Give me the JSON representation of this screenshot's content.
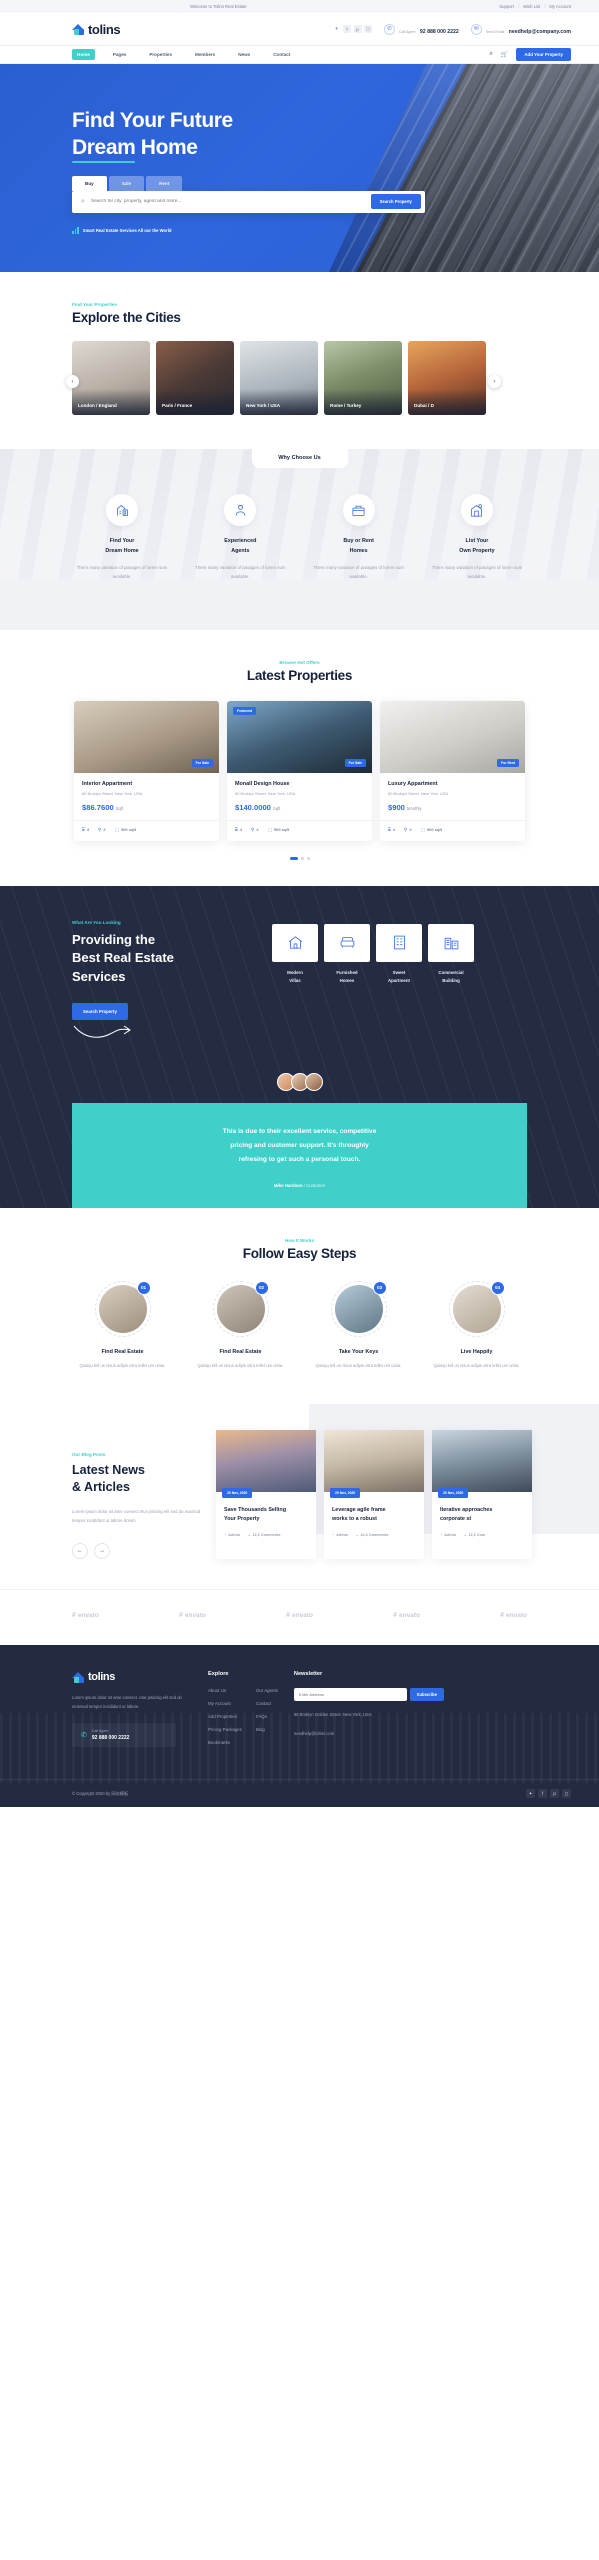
{
  "topbar": {
    "welcome": "Welcome to Tolins Real Estate",
    "links": [
      "Support",
      "Wish List",
      "My Account"
    ]
  },
  "brand": {
    "name": "tolins"
  },
  "header": {
    "social": [
      "twitter-icon",
      "facebook-icon",
      "pinterest-icon",
      "instagram-icon"
    ],
    "call": {
      "label": "Call Agent",
      "value": "92 888 000 2222"
    },
    "email": {
      "label": "Send Email",
      "value": "needhelp@company.com"
    }
  },
  "nav": {
    "items": [
      "Home",
      "Pages",
      "Properties",
      "Members",
      "News",
      "Contact"
    ],
    "active": "Home",
    "search_icon": "search-icon",
    "cart_icon": "cart-icon",
    "cta": "Add Your Property"
  },
  "hero": {
    "title_line1": "Find Your Future",
    "title_line2": "Dream",
    "title_line2_rest": " Home",
    "tabs": [
      "Buy",
      "Sale",
      "Rent"
    ],
    "active_tab": "Buy",
    "search_placeholder": "Search for city, property, agent and more...",
    "search_button": "Search Property",
    "note": "Smart Real Estate Services All our the World"
  },
  "cities": {
    "eyebrow": "Find Your Properties",
    "title": "Explore the Cities",
    "items": [
      {
        "label": "London / England"
      },
      {
        "label": "Paris / France"
      },
      {
        "label": "New York / USA"
      },
      {
        "label": "Rome / Turkey"
      },
      {
        "label": "Dubai / D"
      }
    ],
    "prev": "‹",
    "next": "›"
  },
  "why": {
    "badge": "Why Choose Us",
    "features": [
      {
        "icon": "house-search-icon",
        "title_1": "Find Your",
        "title_2": "Dream Home",
        "text": "There many variation of pasages of lorem sum available."
      },
      {
        "icon": "agent-icon",
        "title_1": "Experienced",
        "title_2": "Agents",
        "text": "There many variation of pasages of lorem sum available."
      },
      {
        "icon": "buy-rent-icon",
        "title_1": "Buy or Rent",
        "title_2": "Homes",
        "text": "There many variation of pasages of lorem sum available."
      },
      {
        "icon": "list-property-icon",
        "title_1": "List Your",
        "title_2": "Own Property",
        "text": "There many variation of pasages of lorem sum available."
      }
    ]
  },
  "properties": {
    "eyebrow": "Browse Hot Offers",
    "title": "Latest Properties",
    "items": [
      {
        "tags": [],
        "badge": "For Sale",
        "name": "Interior Appartment",
        "address": "80 Broklyn Street, New York. USA",
        "price": "$86.7600",
        "unit": "Sqft",
        "beds": "4",
        "baths": "2",
        "area": "500 sqft"
      },
      {
        "tags": [
          "Featured"
        ],
        "badge": "For Sale",
        "name": "Monall Design House",
        "address": "80 Broklyn Street, New York. USA",
        "price": "$140.0000",
        "unit": "Sqft",
        "beds": "4",
        "baths": "2",
        "area": "500 sqft"
      },
      {
        "tags": [],
        "badge": "For Rent",
        "name": "Luxury Appartment",
        "address": "80 Broklyn Street, New York. USA",
        "price": "$900",
        "unit": "Monthly",
        "beds": "4",
        "baths": "2",
        "area": "500 sqft"
      }
    ]
  },
  "services": {
    "eyebrow": "What Are You Looking",
    "title_1": "Providing the",
    "title_2": "Best Real Estate",
    "title_3": "Services",
    "button": "Search Property",
    "cards": [
      {
        "icon": "villa-icon",
        "line1": "Modern",
        "line2": "Villas"
      },
      {
        "icon": "furnished-icon",
        "line1": "Furnished",
        "line2": "Homes"
      },
      {
        "icon": "apartment-icon",
        "line1": "Sweet",
        "line2": "Apartment"
      },
      {
        "icon": "commercial-icon",
        "line1": "Commercial",
        "line2": "Building"
      }
    ]
  },
  "testimonial": {
    "quote_1": "This is due to their excellent service, competitive",
    "quote_2": "pricing and customer support. It's throughly",
    "quote_3": "refresing to get such a personal touch.",
    "author": "Mike Hardson",
    "role": " / Customer"
  },
  "steps": {
    "eyebrow": "How It Works",
    "title": "Follow Easy Steps",
    "items": [
      {
        "num": "01",
        "title": "Find Real Estate",
        "text": "Quisqu tell us nisus adipis vitra tellet um umia."
      },
      {
        "num": "02",
        "title": "Find Real Estate",
        "text": "Quisqu tell us nisus adipis vitra tellet um umia."
      },
      {
        "num": "03",
        "title": "Take Your Keys",
        "text": "Quisqu tell us nisus adipis vitra tellet um umia."
      },
      {
        "num": "04",
        "title": "Live Happily",
        "text": "Quisqu tell us nisus adipis vitra tellet um umia."
      }
    ]
  },
  "blog": {
    "eyebrow": "Our Blog Posts",
    "title_1": "Latest News",
    "title_2": "& Articles",
    "text": "Lorem ipsum dolor sit ame consect etur pisicing elit sed do eusmod tempor incididunt ut labore dolom.",
    "prev": "←",
    "next": "→",
    "posts": [
      {
        "date": "20 Nov, 2020",
        "title_1": "Save Thousands Selling",
        "title_2": "Your Property",
        "author": "Admin",
        "comments": "12,2 Comments"
      },
      {
        "date": "20 Nov, 2020",
        "title_1": "Leverage agile frame",
        "title_2": "works to a robust",
        "author": "Admin",
        "comments": "12,2 Comments"
      },
      {
        "date": "20 Nov, 2020",
        "title_1": "Iterative approaches",
        "title_2": "corporate st",
        "author": "Admin",
        "comments": "12,2 Com"
      }
    ]
  },
  "brands": [
    "envato",
    "envato",
    "envato",
    "envato",
    "envato"
  ],
  "footer": {
    "about": "Lorem ipsum dolor sit ame consect. etur pisicing elit sed do eiusmod tempor incididunt ut labore.",
    "call": {
      "label": "Call Agent",
      "value": "92 888 000 2222"
    },
    "explore_title": "Explore",
    "explore_col1": [
      "About Us",
      "My Account",
      "Add Properties",
      "Pricing Packages",
      "Bookmarks"
    ],
    "explore_col2_title": "Our Agents",
    "explore_col2": [
      "Our Agents",
      "Contact",
      "FAQs",
      "Blog"
    ],
    "newsletter_title": "Newsletter",
    "newsletter_placeholder": "Enter Address",
    "subscribe": "Subscribe",
    "address": "88 Broklyn Golden Street. New York, USA",
    "email": "needhelp@tolins.com",
    "copyright": "© Copyright 2020 by 网站模板",
    "social": [
      "twitter-icon",
      "facebook-icon",
      "pinterest-icon",
      "instagram-icon"
    ]
  },
  "colors": {
    "primary": "#2e6ae6",
    "accent": "#3fd0c9",
    "dark": "#232c43"
  }
}
